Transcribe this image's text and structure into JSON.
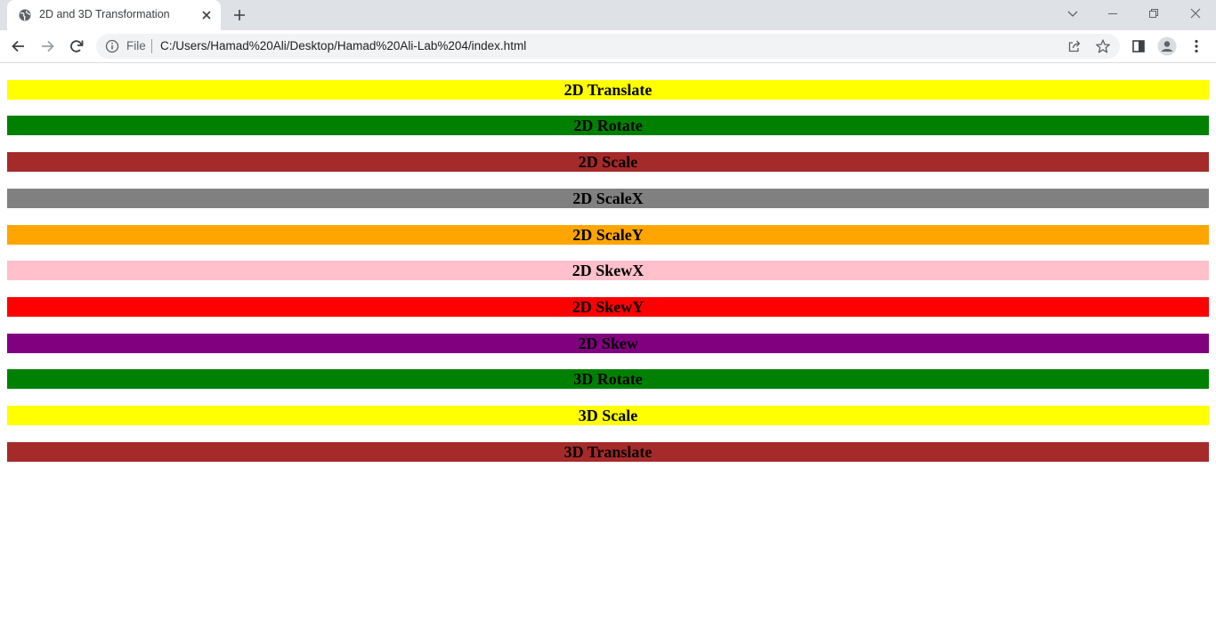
{
  "browser": {
    "tab_title": "2D and 3D Transformation",
    "file_label": "File",
    "url": "C:/Users/Hamad%20Ali/Desktop/Hamad%20Ali-Lab%204/index.html"
  },
  "bars": [
    {
      "label": "2D Translate",
      "color": "#ffff00"
    },
    {
      "label": "2D Rotate",
      "color": "#008000"
    },
    {
      "label": "2D Scale",
      "color": "#a52a2a"
    },
    {
      "label": "2D ScaleX",
      "color": "#808080"
    },
    {
      "label": "2D ScaleY",
      "color": "#ffa500"
    },
    {
      "label": "2D SkewX",
      "color": "#ffc0cb"
    },
    {
      "label": "2D SkewY",
      "color": "#ff0000"
    },
    {
      "label": "2D Skew",
      "color": "#800080"
    },
    {
      "label": "3D Rotate",
      "color": "#008000"
    },
    {
      "label": "3D Scale",
      "color": "#ffff00"
    },
    {
      "label": "3D Translate",
      "color": "#a52a2a"
    }
  ]
}
